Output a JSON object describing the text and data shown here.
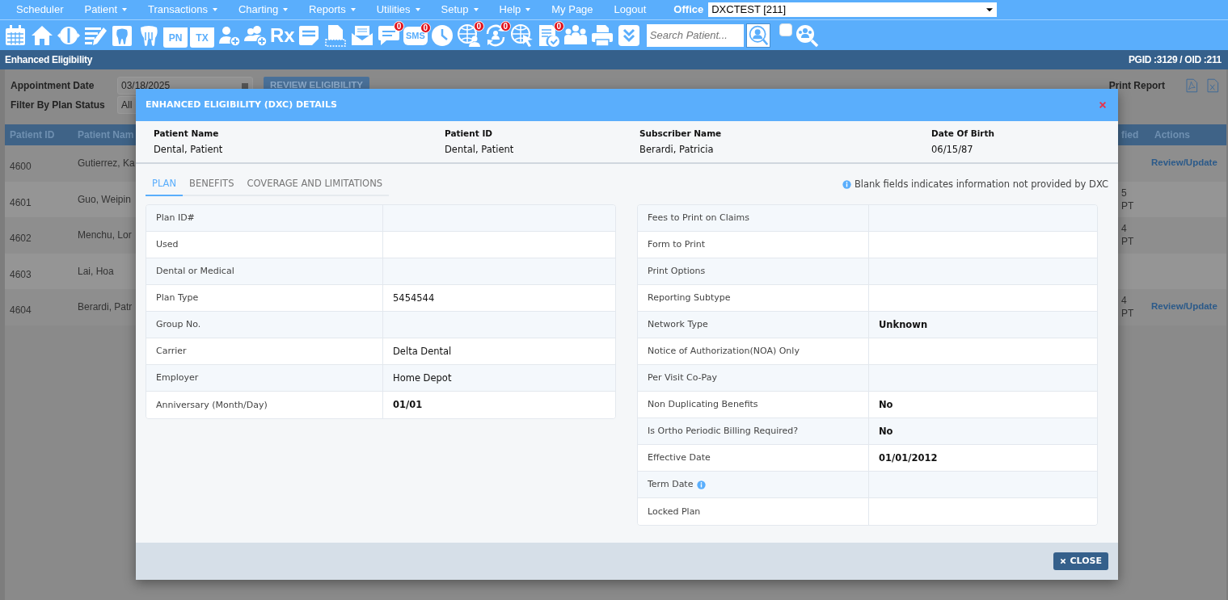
{
  "menu": [
    {
      "label": "Scheduler",
      "dropdown": false
    },
    {
      "label": "Patient",
      "dropdown": true
    },
    {
      "label": "Transactions",
      "dropdown": true
    },
    {
      "label": "Charting",
      "dropdown": true
    },
    {
      "label": "Reports",
      "dropdown": true
    },
    {
      "label": "Utilities",
      "dropdown": true
    },
    {
      "label": "Setup",
      "dropdown": true
    },
    {
      "label": "Help",
      "dropdown": true
    },
    {
      "label": "My Page",
      "dropdown": false
    },
    {
      "label": "Logout",
      "dropdown": false
    }
  ],
  "office": {
    "label": "Office",
    "value": "DXCTEST [211]"
  },
  "toolbar": {
    "labels": [
      "PN",
      "TX",
      "Rx",
      "SMS"
    ],
    "badges": [
      "0",
      "0",
      "0",
      "0",
      "0"
    ],
    "search": {
      "placeholder": "Search Patient..."
    },
    "checkbox": {
      "checked": false
    }
  },
  "page": {
    "title": "Enhanced Eligibility",
    "ids": "PGID :3129 / OID :211"
  },
  "filters": {
    "date_label": "Appointment Date",
    "date_value": "03/18/2025",
    "review_button": "REVIEW ELIGIBILITY",
    "status_label": "Filter By Plan Status",
    "status_value": "All",
    "print_report": "Print Report"
  },
  "table": {
    "columns": [
      "Patient ID",
      "Patient Nam",
      "fied",
      "Actions"
    ],
    "rows": [
      {
        "patient_id": "4600",
        "patient_name": "Gutierrez, Ka",
        "action": "Review/Update"
      },
      {
        "patient_id": "4601",
        "patient_name": "Guo, Weipin",
        "column_3": "5\nPT"
      },
      {
        "patient_id": "4602",
        "patient_name": "Menchu, Lor",
        "column_3": "4\nPT"
      },
      {
        "patient_id": "4603",
        "patient_name": "Lai, Hoa"
      },
      {
        "patient_id": "4604",
        "patient_name": "Berardi, Patr",
        "column_3": "4\nPT",
        "action": "Review/Update"
      }
    ]
  },
  "modal": {
    "title": "ENHANCED ELIGIBILITY (DXC) DETAILS",
    "header_fields": [
      {
        "label": "Patient Name",
        "value": "Dental, Patient"
      },
      {
        "label": "Patient ID",
        "value": "Dental, Patient"
      },
      {
        "label": "Subscriber Name",
        "value": "Berardi, Patricia"
      },
      {
        "label": "Date Of Birth",
        "value": "06/15/87"
      }
    ],
    "tabs": [
      {
        "label": "PLAN",
        "selected": true
      },
      {
        "label": "BENEFITS",
        "selected": false
      },
      {
        "label": "COVERAGE AND LIMITATIONS",
        "selected": false
      }
    ],
    "note": "Blank fields indicates information not provided by DXC",
    "plan_left": [
      {
        "label": "Plan ID#"
      },
      {
        "label": "Used"
      },
      {
        "label": "Dental or Medical"
      },
      {
        "label": "Plan Type",
        "value": "5454544",
        "bold": false
      },
      {
        "label": "Group No."
      },
      {
        "label": "Carrier",
        "value": "Delta Dental",
        "bold": false
      },
      {
        "label": "Employer",
        "value": "Home Depot",
        "bold": false
      },
      {
        "label": "Anniversary (Month/Day)",
        "value": "01/01",
        "bold": true
      }
    ],
    "plan_right": [
      {
        "label": "Fees to Print on Claims"
      },
      {
        "label": "Form to Print"
      },
      {
        "label": "Print Options"
      },
      {
        "label": "Reporting Subtype"
      },
      {
        "label": "Network Type",
        "value": "Unknown",
        "bold": true
      },
      {
        "label": "Notice of Authorization(NOA) Only"
      },
      {
        "label": "Per Visit Co-Pay"
      },
      {
        "label": "Non Duplicating Benefits",
        "value": "No",
        "bold": true
      },
      {
        "label": "Is Ortho Periodic Billing Required?",
        "value": "No",
        "bold": true
      },
      {
        "label": "Effective Date",
        "value": "01/01/2012",
        "bold": true
      },
      {
        "label": "Term Date",
        "info": true
      },
      {
        "label": "Locked Plan"
      }
    ],
    "close_button": "CLOSE"
  }
}
